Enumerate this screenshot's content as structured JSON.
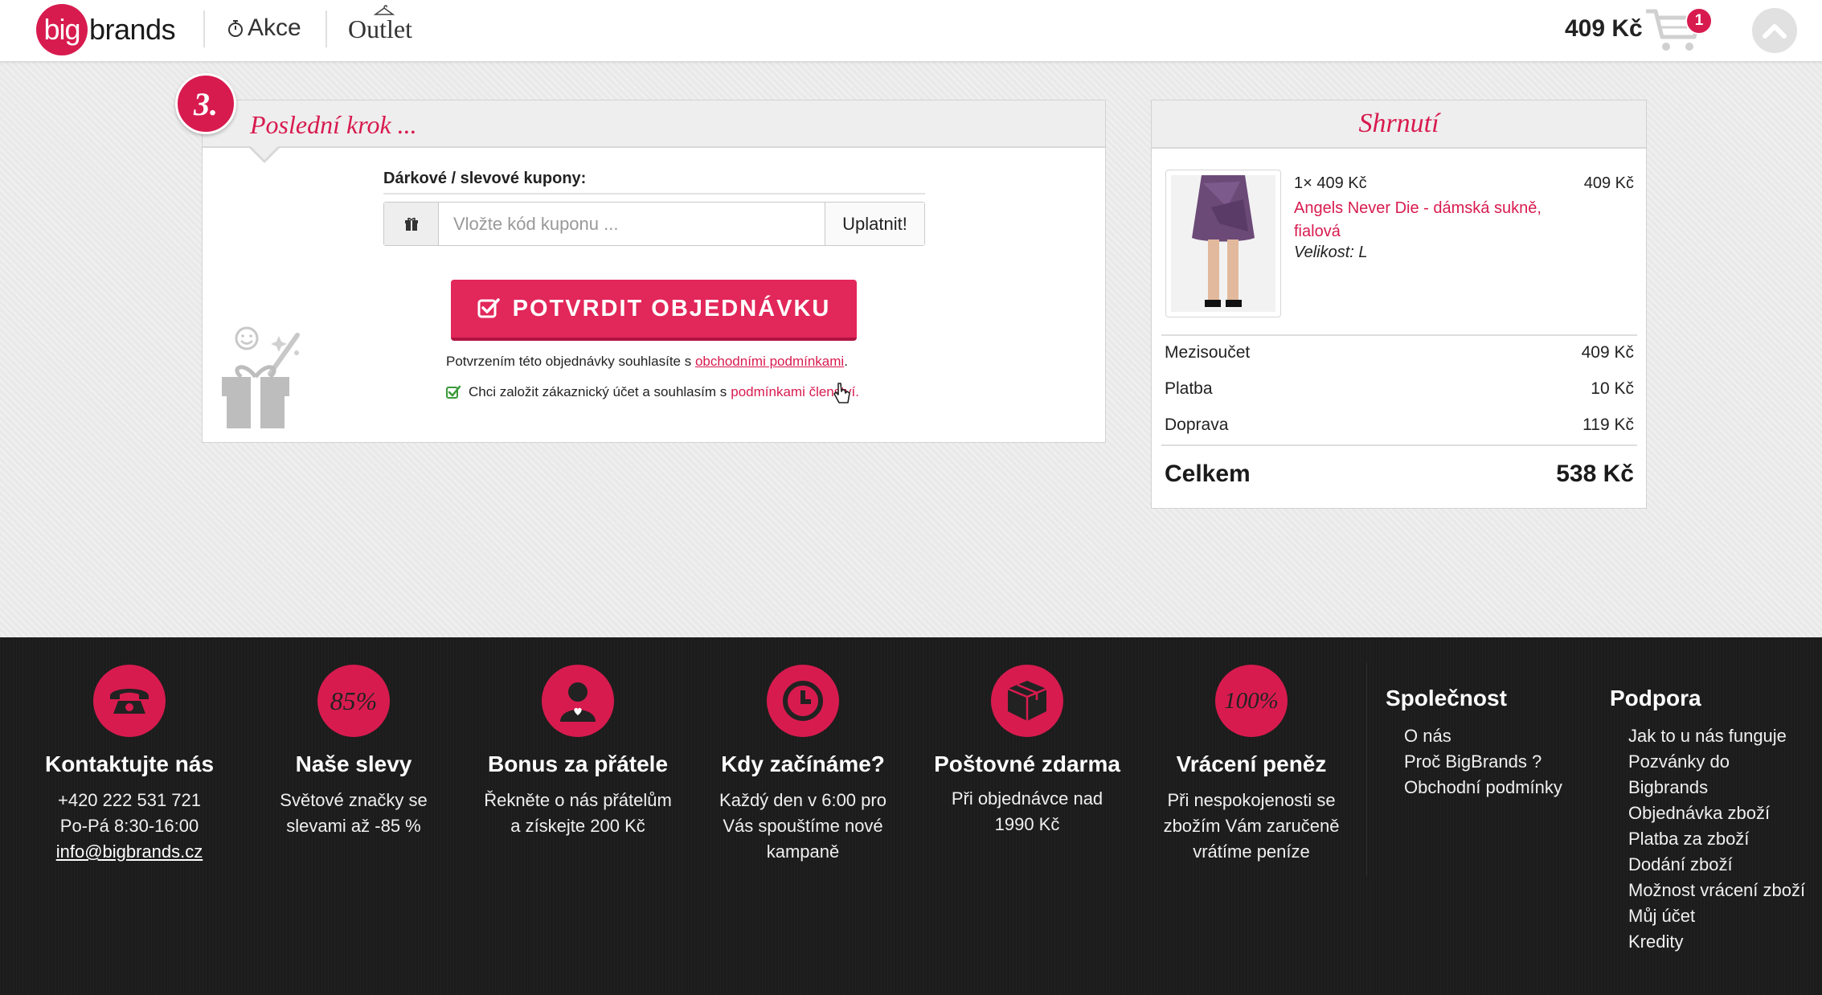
{
  "header": {
    "logo_big": "big",
    "logo_brands": "brands",
    "nav_akce": "Akce",
    "nav_outlet": "Outlet",
    "cart_total": "409 Kč",
    "cart_count": "1"
  },
  "step": {
    "number": "3.",
    "title": "Poslední krok ...",
    "coupon_label": "Dárkové / slevové kupony:",
    "coupon_placeholder": "Vložte kód kuponu ...",
    "coupon_button": "Uplatnit!",
    "confirm_button": "POTVRDIT OBJEDNÁVKU",
    "terms_text": "Potvrzením této objednávky souhlasíte s",
    "terms_link": "obchodními podmínkami",
    "terms_end": ".",
    "account_text": "Chci založit zákaznický účet a souhlasím s",
    "account_link": "podmínkami členství."
  },
  "summary": {
    "title": "Shrnutí",
    "item": {
      "qty_price": "1× 409 Kč",
      "price": "409 Kč",
      "name": "Angels Never Die - dámská sukně, fialová",
      "size": "Velikost: L"
    },
    "rows": [
      {
        "label": "Mezisoučet",
        "value": "409 Kč"
      },
      {
        "label": "Platba",
        "value": "10 Kč"
      },
      {
        "label": "Doprava",
        "value": "119 Kč"
      }
    ],
    "total_label": "Celkem",
    "total_value": "538 Kč"
  },
  "footer": {
    "cols": [
      {
        "icon": "phone-icon",
        "title": "Kontaktujte nás",
        "lines": [
          "+420 222 531 721",
          "Po-Pá 8:30-16:00"
        ],
        "link": "info@bigbrands.cz"
      },
      {
        "icon": "percent-icon",
        "icon_text": "85%",
        "title": "Naše slevy",
        "text": "Světové značky se slevami až -85 %"
      },
      {
        "icon": "person-icon",
        "title": "Bonus za přátele",
        "text": "Řekněte o nás přátelům a získejte 200 Kč"
      },
      {
        "icon": "clock-icon",
        "title": "Kdy začínáme?",
        "text": "Každý den v 6:00 pro Vás spouštíme nové kampaně"
      },
      {
        "icon": "box-icon",
        "title": "Poštovné zdarma",
        "text": "Při objednávce nad 1990 Kč"
      },
      {
        "icon": "hundred-percent-icon",
        "icon_text": "100%",
        "title": "Vrácení peněz",
        "text": "Při nespokojenosti se zbožím Vám zaručeně vrátíme peníze"
      }
    ],
    "company": {
      "title": "Společnost",
      "links": [
        "O nás",
        "Proč BigBrands ?",
        "Obchodní podmínky"
      ]
    },
    "support": {
      "title": "Podpora",
      "links": [
        "Jak to u nás funguje",
        "Pozvánky do Bigbrands",
        "Objednávka zboží",
        "Platba za zboží",
        "Dodání zboží",
        "Možnost vrácení zboží",
        "Můj účet",
        "Kredity"
      ]
    }
  }
}
